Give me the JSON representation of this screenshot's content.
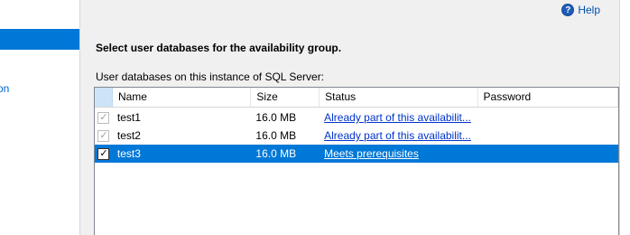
{
  "left_nav": {
    "partial_item": "tion"
  },
  "help": {
    "label": "Help"
  },
  "page": {
    "heading": "Select user databases for the availability group.",
    "sublabel": "User databases on this instance of SQL Server:"
  },
  "grid": {
    "columns": [
      "Name",
      "Size",
      "Status",
      "Password"
    ],
    "rows": [
      {
        "name": "test1",
        "size": "16.0 MB",
        "status": "Already part of this availabilit...",
        "password": "",
        "checked": true,
        "enabled": false,
        "selected": false
      },
      {
        "name": "test2",
        "size": "16.0 MB",
        "status": "Already part of this availabilit...",
        "password": "",
        "checked": true,
        "enabled": false,
        "selected": false
      },
      {
        "name": "test3",
        "size": "16.0 MB",
        "status": "Meets prerequisites",
        "password": "",
        "checked": true,
        "enabled": true,
        "selected": true
      }
    ]
  },
  "colors": {
    "selection": "#0078d7",
    "link": "#0033cc",
    "panel_bg": "#f0f0f0"
  }
}
